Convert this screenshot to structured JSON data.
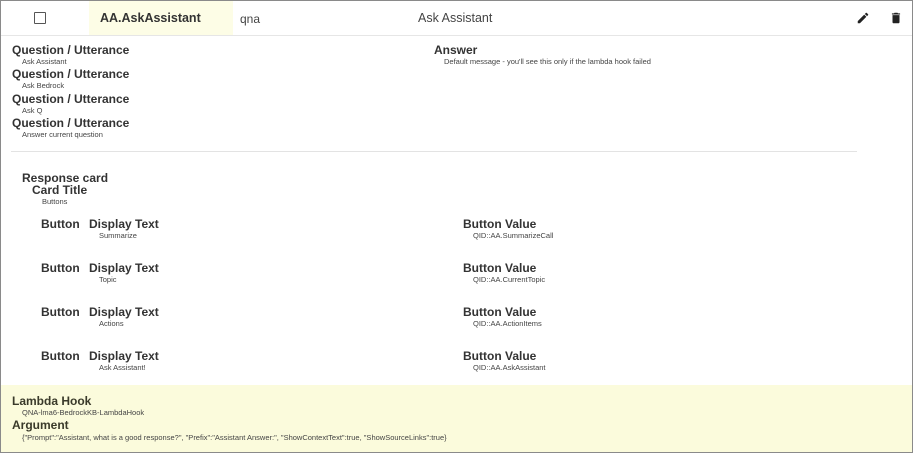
{
  "header": {
    "qid": "AA.AskAssistant",
    "type": "qna",
    "title": "Ask Assistant",
    "edit_icon": "pencil-icon",
    "delete_icon": "trash-icon"
  },
  "questions": {
    "label": "Question / Utterance",
    "items": [
      "Ask Assistant",
      "Ask Bedrock",
      "Ask Q",
      "Answer current question"
    ]
  },
  "answer": {
    "label": "Answer",
    "value": "Default message - you'll see this only if the lambda hook failed"
  },
  "response_card": {
    "label": "Response card",
    "card_title_label": "Card Title",
    "card_title_value": "Buttons",
    "button_label": "Button",
    "display_text_label": "Display Text",
    "button_value_label": "Button Value",
    "buttons": [
      {
        "display_text": "Summarize",
        "value": "QID::AA.SummarizeCall"
      },
      {
        "display_text": "Topic",
        "value": "QID::AA.CurrentTopic"
      },
      {
        "display_text": "Actions",
        "value": "QID::AA.ActionItems"
      },
      {
        "display_text": "Ask Assistant!",
        "value": "QID::AA.AskAssistant"
      }
    ]
  },
  "lambda": {
    "hook_label": "Lambda Hook",
    "hook_value": "QNA-lma6-BedrockKB-LambdaHook",
    "argument_label": "Argument",
    "argument_value": "{\"Prompt\":\"Assistant, what is a good response?\", \"Prefix\":\"Assistant Answer:\", \"ShowContextText\":true, \"ShowSourceLinks\":true}"
  },
  "colors": {
    "highlight": "#fdfde6",
    "lambda_bg": "#fbfbdc"
  }
}
